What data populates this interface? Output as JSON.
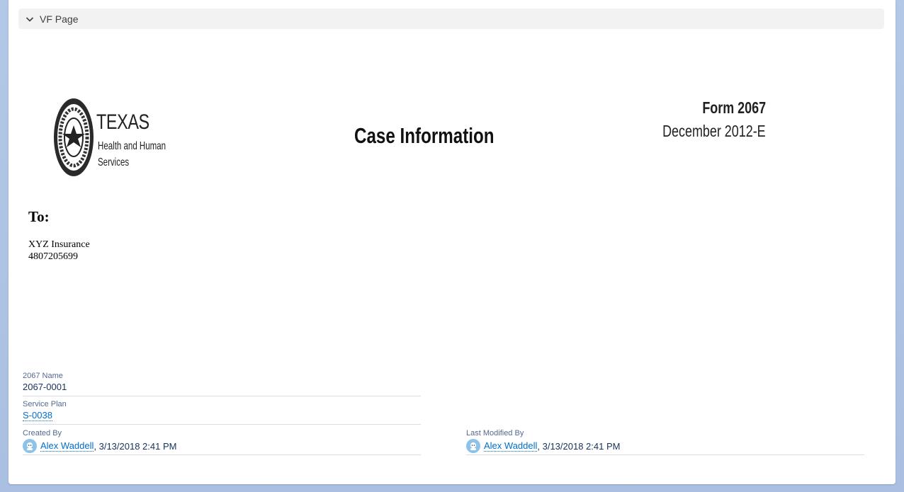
{
  "section": {
    "title": "VF Page"
  },
  "logo": {
    "line1": "TEXAS",
    "line2": "Health and Human",
    "line3": "Services"
  },
  "document": {
    "title": "Case Information",
    "form_number": "Form 2067",
    "form_date": "December 2012-E",
    "to_label": "To:",
    "recipient_name": "XYZ Insurance",
    "recipient_phone": "4807205699"
  },
  "fields": {
    "name": {
      "label": "2067 Name",
      "value": "2067-0001"
    },
    "service_plan": {
      "label": "Service Plan",
      "value": "S-0038"
    },
    "created_by": {
      "label": "Created By",
      "user": "Alex Waddell",
      "date": ", 3/13/2018 2:41 PM"
    },
    "last_modified_by": {
      "label": "Last Modified By",
      "user": "Alex Waddell",
      "date": ", 3/13/2018 2:41 PM"
    }
  },
  "colors": {
    "link": "#006dcc",
    "label": "#54698d",
    "header_bg": "#f3f2f2",
    "page_bg": "#b3c8e6"
  }
}
